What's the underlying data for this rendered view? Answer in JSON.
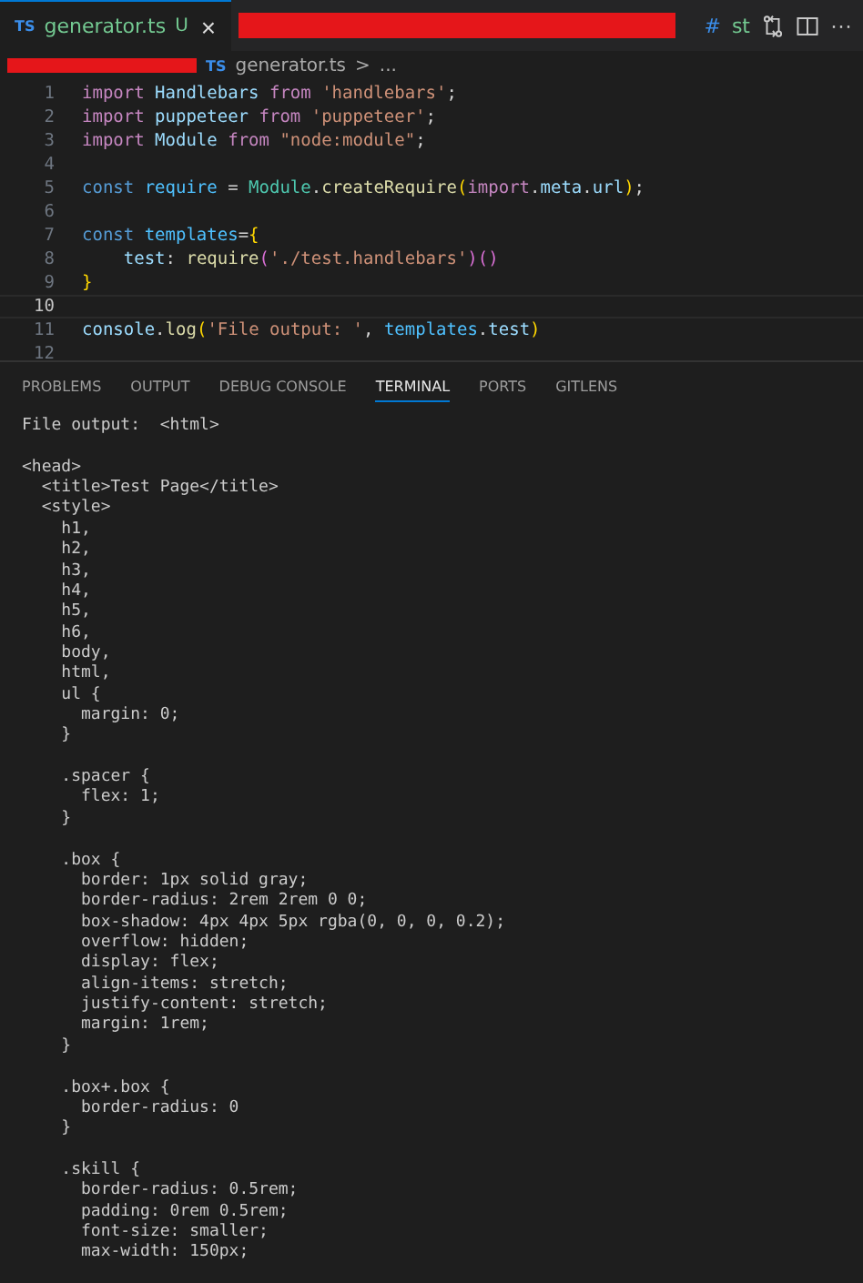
{
  "editor_tabs": [
    {
      "kind": "file",
      "icon": "TS",
      "label": "generator.ts",
      "badge": "U",
      "close": "×",
      "selected": true
    }
  ],
  "tab_actions": {
    "texts": [
      "#",
      "st"
    ],
    "more": "···"
  },
  "breadcrumb": {
    "icon": "TS",
    "file": "generator.ts",
    "separator": ">",
    "rest": "..."
  },
  "code_lines": [
    {
      "number": "1",
      "current": false,
      "tokens": [
        {
          "kind": "keyword",
          "text": "import"
        },
        {
          "kind": "ident",
          "text": " Handlebars"
        },
        {
          "kind": "keyword",
          "text": " from"
        },
        {
          "kind": "string",
          "text": " 'handlebars'"
        },
        {
          "kind": "plain",
          "text": ";"
        }
      ]
    },
    {
      "number": "2",
      "current": false,
      "tokens": [
        {
          "kind": "keyword",
          "text": "import"
        },
        {
          "kind": "ident",
          "text": " puppeteer"
        },
        {
          "kind": "keyword",
          "text": " from"
        },
        {
          "kind": "string",
          "text": " 'puppeteer'"
        },
        {
          "kind": "plain",
          "text": ";"
        }
      ]
    },
    {
      "number": "3",
      "current": false,
      "tokens": [
        {
          "kind": "keyword",
          "text": "import"
        },
        {
          "kind": "ident",
          "text": " Module"
        },
        {
          "kind": "keyword",
          "text": " from"
        },
        {
          "kind": "string",
          "text": " \"node:module\""
        },
        {
          "kind": "plain",
          "text": ";"
        }
      ]
    },
    {
      "number": "4",
      "current": false
    },
    {
      "number": "5",
      "current": false,
      "tokens": [
        {
          "kind": "storage",
          "text": "const"
        },
        {
          "kind": "constant",
          "text": " require"
        },
        {
          "kind": "plain",
          "text": " = "
        },
        {
          "kind": "type",
          "text": "Module"
        },
        {
          "kind": "plain",
          "text": "."
        },
        {
          "kind": "func",
          "text": "createRequire"
        },
        {
          "kind": "bracket",
          "text": "("
        },
        {
          "kind": "keyword",
          "text": "import"
        },
        {
          "kind": "plain",
          "text": "."
        },
        {
          "kind": "ident",
          "text": "meta"
        },
        {
          "kind": "plain",
          "text": "."
        },
        {
          "kind": "ident",
          "text": "url"
        },
        {
          "kind": "bracket",
          "text": ")"
        },
        {
          "kind": "plain",
          "text": ";"
        }
      ]
    },
    {
      "number": "6",
      "current": false
    },
    {
      "number": "7",
      "current": false,
      "tokens": [
        {
          "kind": "storage",
          "text": "const"
        },
        {
          "kind": "constant",
          "text": " templates"
        },
        {
          "kind": "plain",
          "text": "="
        },
        {
          "kind": "bracket",
          "text": "{"
        }
      ]
    },
    {
      "number": "8",
      "current": false,
      "tokens": [
        {
          "kind": "ident",
          "text": "    test"
        },
        {
          "kind": "plain",
          "text": ": "
        },
        {
          "kind": "func",
          "text": "require"
        },
        {
          "kind": "bracket2",
          "text": "("
        },
        {
          "kind": "string",
          "text": "'./test.handlebars'"
        },
        {
          "kind": "bracket2",
          "text": ")()"
        }
      ]
    },
    {
      "number": "9",
      "current": false,
      "tokens": [
        {
          "kind": "bracket",
          "text": "}"
        }
      ]
    },
    {
      "number": "10",
      "current": true
    },
    {
      "number": "11",
      "current": false,
      "tokens": [
        {
          "kind": "ident",
          "text": "console"
        },
        {
          "kind": "plain",
          "text": "."
        },
        {
          "kind": "func",
          "text": "log"
        },
        {
          "kind": "bracket",
          "text": "("
        },
        {
          "kind": "string",
          "text": "'File output: '"
        },
        {
          "kind": "plain",
          "text": ", "
        },
        {
          "kind": "constant",
          "text": "templates"
        },
        {
          "kind": "plain",
          "text": "."
        },
        {
          "kind": "ident",
          "text": "test"
        },
        {
          "kind": "bracket",
          "text": ")"
        }
      ]
    },
    {
      "number": "12",
      "current": false
    }
  ],
  "panel_tabs": [
    {
      "label": "PROBLEMS",
      "selected": false
    },
    {
      "label": "OUTPUT",
      "selected": false
    },
    {
      "label": "DEBUG CONSOLE",
      "selected": false
    },
    {
      "label": "TERMINAL",
      "selected": true
    },
    {
      "label": "PORTS",
      "selected": false
    },
    {
      "label": "GITLENS",
      "selected": false
    }
  ],
  "terminal_blocks": [
    [
      "File output:  <html>"
    ],
    [
      "<head>",
      "  <title>Test Page</title>",
      "  <style>",
      "    h1,",
      "    h2,",
      "    h3,",
      "    h4,",
      "    h5,",
      "    h6,",
      "    body,",
      "    html,",
      "    ul {",
      "      margin: 0;",
      "    }"
    ],
    [
      "    .spacer {",
      "      flex: 1;",
      "    }"
    ],
    [
      "    .box {",
      "      border: 1px solid gray;",
      "      border-radius: 2rem 2rem 0 0;",
      "      box-shadow: 4px 4px 5px rgba(0, 0, 0, 0.2);",
      "      overflow: hidden;",
      "      display: flex;",
      "      align-items: stretch;",
      "      justify-content: stretch;",
      "      margin: 1rem;",
      "    }"
    ],
    [
      "    .box+.box {",
      "      border-radius: 0",
      "    }"
    ],
    [
      "    .skill {",
      "      border-radius: 0.5rem;",
      "      padding: 0rem 0.5rem;",
      "      font-size: smaller;",
      "      max-width: 150px;"
    ]
  ]
}
